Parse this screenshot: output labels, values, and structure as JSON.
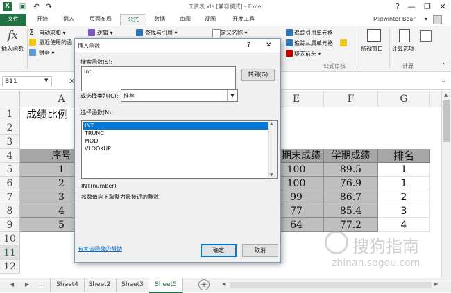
{
  "window": {
    "title": "工资表.xls  [兼容模式] - Excel",
    "help": "?",
    "min": "—",
    "restore": "❐",
    "close": "✕"
  },
  "quick_access": {
    "save_icon": "save-icon",
    "undo": "↶",
    "redo": "↷"
  },
  "ribbon_tabs": [
    {
      "label": "文件"
    },
    {
      "label": "开始"
    },
    {
      "label": "插入"
    },
    {
      "label": "页面布局"
    },
    {
      "label": "公式"
    },
    {
      "label": "数据"
    },
    {
      "label": "审阅"
    },
    {
      "label": "视图"
    },
    {
      "label": "开发工具"
    }
  ],
  "user": {
    "name": "Midwinter Bear",
    "arrow": "▾"
  },
  "ribbon": {
    "insert_function": {
      "icon_text": "fx",
      "label": "插入函数"
    },
    "autosum": "自动求和 ▾",
    "recent": "最近使用的函",
    "financial": "财务 ▾",
    "logical": "逻辑 ▾",
    "lookup": "查找与引用 ▾",
    "define_name": "定义名称 ▾",
    "trace_precedents": "追踪引用单元格",
    "trace_dependents": "追踪从属单元格",
    "remove_arrows": "移去箭头 ▾",
    "watch_window": "监视窗口",
    "calc_options": "计算选项",
    "group_audit": "公式审核",
    "group_calc": "计算"
  },
  "formula_bar": {
    "name_box": "B11",
    "cancel": "✕"
  },
  "columns": [
    "A",
    "E",
    "F",
    "G"
  ],
  "rows": [
    "1",
    "2",
    "3",
    "4",
    "5",
    "6",
    "7",
    "8",
    "9",
    "10",
    "11",
    "12"
  ],
  "sheet": {
    "title_cell": "成绩比例",
    "headers": {
      "seq": "序号",
      "final": "期末成绩",
      "term": "学期成绩",
      "rank": "排名"
    },
    "data": [
      {
        "seq": "1",
        "final": "100",
        "term": "89.5",
        "rank": "1"
      },
      {
        "seq": "2",
        "final": "100",
        "term": "76.9",
        "rank": "1"
      },
      {
        "seq": "3",
        "final": "99",
        "term": "86.7",
        "rank": "2"
      },
      {
        "seq": "4",
        "final": "77",
        "term": "85.4",
        "rank": "3"
      },
      {
        "seq": "5",
        "final": "64",
        "term": "77.2",
        "rank": "4"
      }
    ]
  },
  "sheet_tabs": [
    {
      "label": "Sheet4"
    },
    {
      "label": "Sheet2"
    },
    {
      "label": "Sheet3"
    },
    {
      "label": "Sheet5"
    }
  ],
  "sheet_nav": {
    "prev": "◀",
    "next": "▶",
    "more": "...",
    "add": "+"
  },
  "dialog": {
    "title": "插入函数",
    "help": "?",
    "close": "✕",
    "search_label": "搜索函数(S):",
    "search_value": "int",
    "go_button": "转到(G)",
    "category_label": "或选择类别(C):",
    "category_value": "推荐",
    "select_label": "选择函数(N):",
    "functions": [
      "INT",
      "TRUNC",
      "MOD",
      "VLOOKUP"
    ],
    "signature": "INT(number)",
    "description": "将数值向下取整为最接近的整数",
    "help_link": "有关该函数的帮助",
    "ok": "确定",
    "cancel": "取消"
  },
  "watermark": {
    "brand": "搜狗指南",
    "url": "zhinan.sogou.com"
  }
}
